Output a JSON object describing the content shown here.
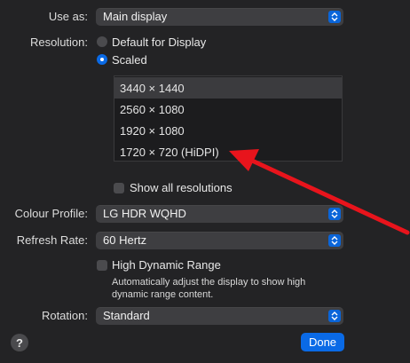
{
  "use_as": {
    "label": "Use as:",
    "value": "Main display"
  },
  "resolution": {
    "label": "Resolution:",
    "options": [
      "Default for Display",
      "Scaled"
    ],
    "selected": "Scaled",
    "list": [
      "3440 × 1440",
      "2560 × 1080",
      "1920 × 1080",
      "1720 × 720 (HiDPI)"
    ],
    "selected_index": 0,
    "show_all_label": "Show all resolutions"
  },
  "colour_profile": {
    "label": "Colour Profile:",
    "value": "LG HDR WQHD"
  },
  "refresh_rate": {
    "label": "Refresh Rate:",
    "value": "60 Hertz"
  },
  "hdr": {
    "label": "High Dynamic Range",
    "description_line1": "Automatically adjust the display to show high",
    "description_line2": "dynamic range content."
  },
  "rotation": {
    "label": "Rotation:",
    "value": "Standard"
  },
  "footer": {
    "help": "?",
    "done": "Done"
  },
  "colors": {
    "accent": "#0a6ae6",
    "arrow": "#e8141c",
    "background": "#232325"
  },
  "icons": {
    "popup_stepper": "up-down-chevron-icon",
    "annotation": "red-arrow"
  }
}
